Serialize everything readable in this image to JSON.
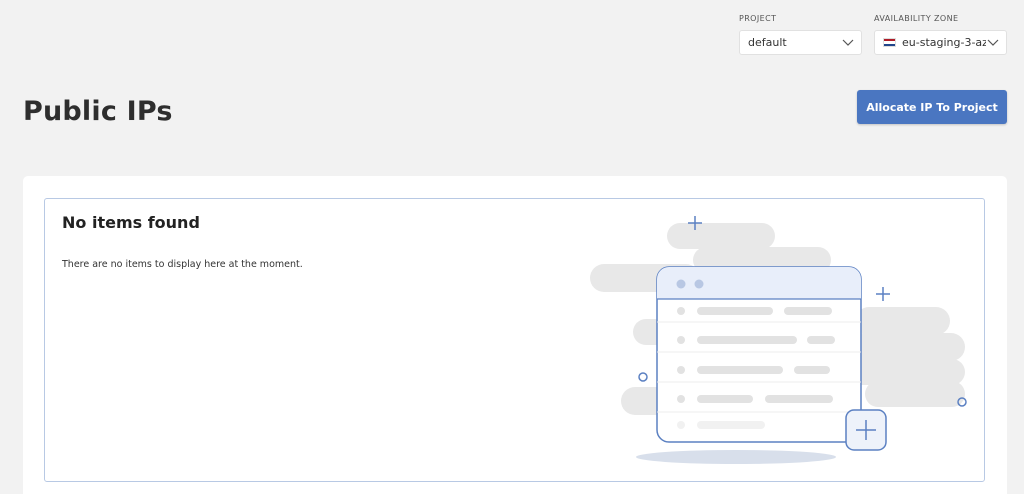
{
  "filters": {
    "project": {
      "label": "PROJECT",
      "value": "default"
    },
    "availability_zone": {
      "label": "AVAILABILITY ZONE",
      "value": "eu-staging-3-az",
      "flag_colors": [
        "#ae1c28",
        "#ffffff",
        "#21468b"
      ]
    }
  },
  "header": {
    "title": "Public IPs",
    "allocate_button_label": "Allocate IP To Project"
  },
  "empty_state": {
    "title": "No items found",
    "message": "There are no items to display here at the moment."
  },
  "colors": {
    "accent": "#4a76c1",
    "panel_border": "#b8c9e4",
    "background": "#f2f2f2"
  }
}
